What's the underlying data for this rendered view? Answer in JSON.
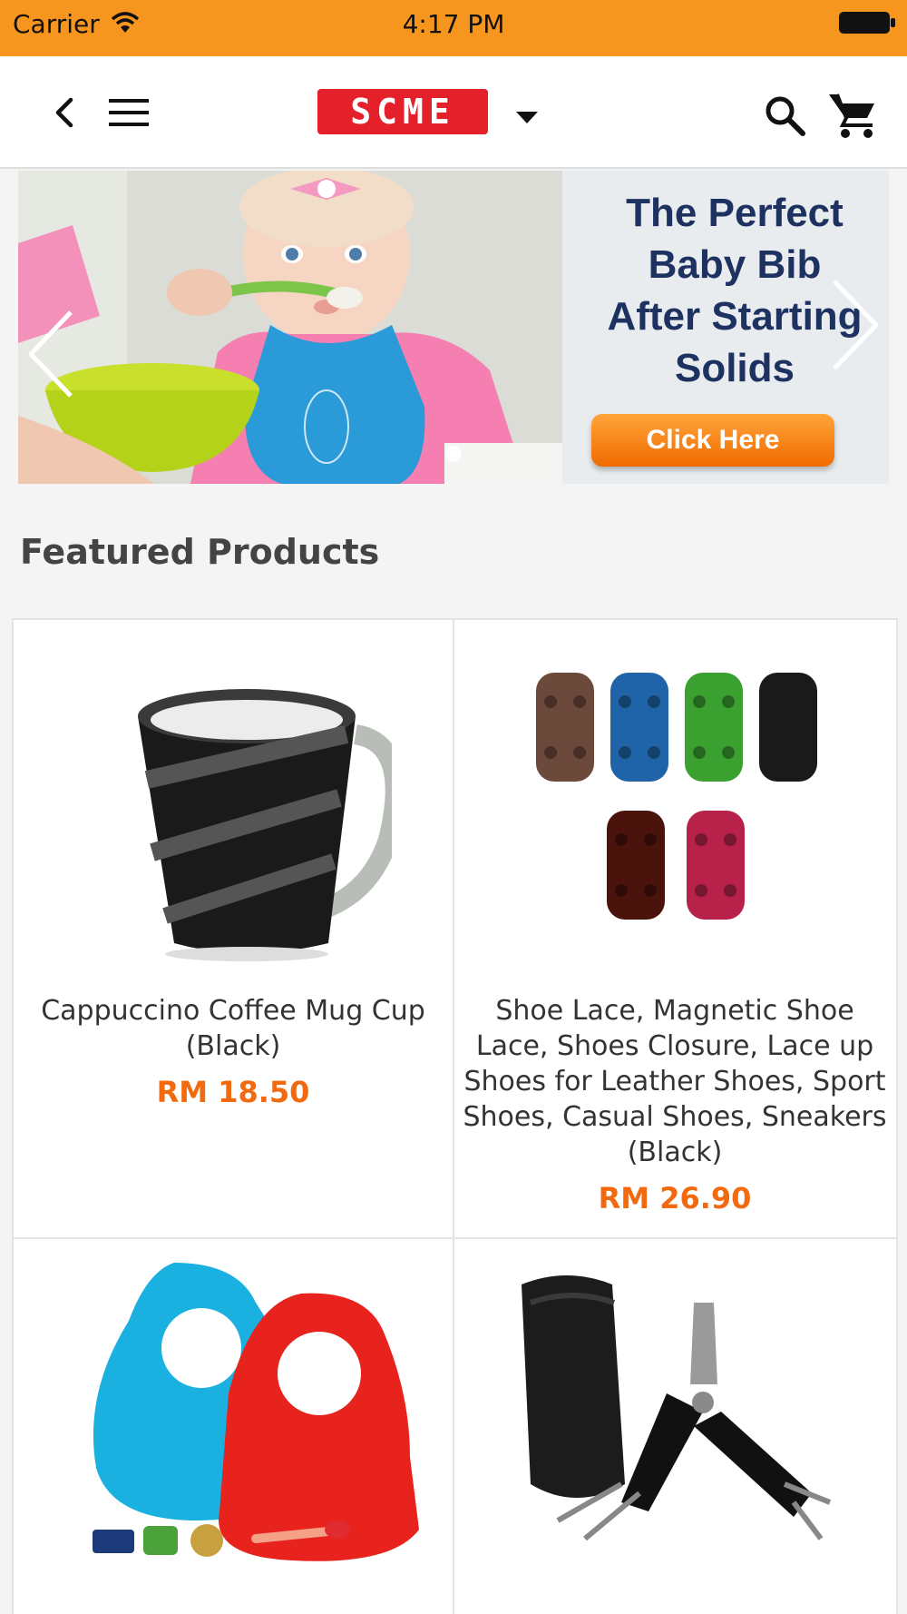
{
  "status_bar": {
    "carrier": "Carrier",
    "time": "4:17 PM"
  },
  "nav": {
    "logo_text": "SCME",
    "icons": [
      "back-icon",
      "menu-icon",
      "dropdown-icon",
      "search-icon",
      "cart-icon"
    ]
  },
  "banner": {
    "headline_lines": [
      "The Perfect",
      "Baby Bib",
      "After Starting",
      "Solids"
    ],
    "cta": "Click Here",
    "slide_count": 1,
    "active_slide": 1
  },
  "section_title": "Featured Products",
  "products": [
    {
      "name": "Cappuccino Coffee Mug Cup (Black)",
      "price": "RM 18.50",
      "image": "coffee-mug"
    },
    {
      "name": "Shoe Lace, Magnetic Shoe Lace, Shoes Closure, Lace up Shoes for Leather Shoes, Sport Shoes, Casual Shoes, Sneakers (Black)",
      "price": "RM 26.90",
      "image": "magnetic-shoe-lace-clips"
    },
    {
      "name": "",
      "price": "",
      "image": "silicone-baby-bibs"
    },
    {
      "name": "",
      "price": "",
      "image": "multi-tool-pliers"
    }
  ],
  "colors": {
    "status_bar": "#f7961e",
    "brand_red": "#e4202a",
    "price_orange": "#f26a10",
    "banner_text": "#1d3260"
  }
}
